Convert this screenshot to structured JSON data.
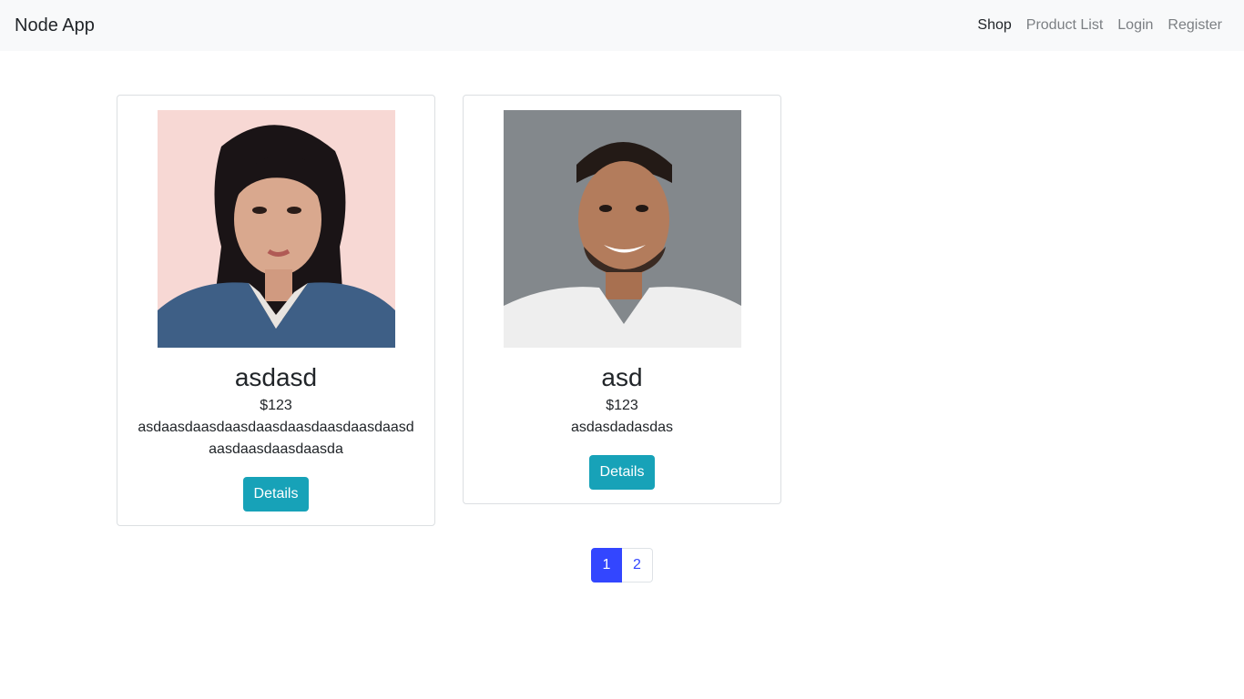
{
  "navbar": {
    "brand": "Node App",
    "links": [
      {
        "label": "Shop",
        "active": true
      },
      {
        "label": "Product List",
        "active": false
      },
      {
        "label": "Login",
        "active": false
      },
      {
        "label": "Register",
        "active": false
      }
    ]
  },
  "products": [
    {
      "title": "asdasd",
      "price": "$123",
      "description": "asdaasdaasdaasdaasdaasdaasdaasdaasdaasdaasdaasdaasda",
      "button": "Details"
    },
    {
      "title": "asd",
      "price": "$123",
      "description": "asdasdadasdas",
      "button": "Details"
    }
  ],
  "pagination": {
    "pages": [
      "1",
      "2"
    ],
    "current": "1"
  },
  "colors": {
    "accent": "#17a2b8",
    "primary": "#3346ff",
    "navbar_bg": "#f8f9fa"
  }
}
